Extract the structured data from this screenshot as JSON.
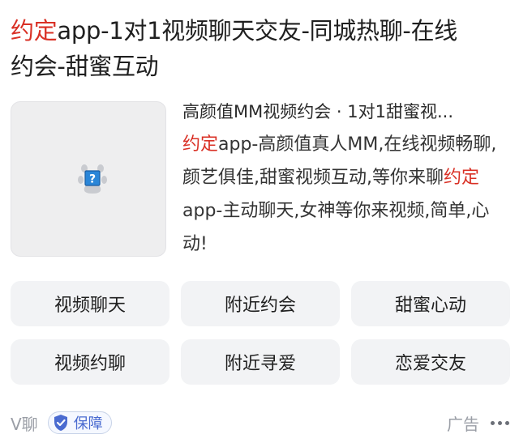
{
  "title": {
    "highlight": "约定",
    "rest_line1": "app-1对1视频聊天交友-同城热聊-在线",
    "line2": "约会-甜蜜互动"
  },
  "desc": {
    "subtitle": "高颜值MM视频约会 · 1对1甜蜜视...",
    "body": [
      {
        "text": "约定",
        "hl": true
      },
      {
        "text": "app-高颜值真人MM,在线视频畅聊,颜艺俱佳,甜蜜视频互动,等你来聊",
        "hl": false
      },
      {
        "text": "约定",
        "hl": true
      },
      {
        "text": "app-主动聊天,女神等你来视频,简单,心动!",
        "hl": false
      }
    ]
  },
  "thumbnail": {
    "icon": "broken-image-paw-icon"
  },
  "tags": [
    "视频聊天",
    "附近约会",
    "甜蜜心动",
    "视频约聊",
    "附近寻爱",
    "恋爱交友"
  ],
  "footer": {
    "source": "V聊",
    "badge": "保障",
    "ad_label": "广告",
    "more_icon": "more-dots-icon"
  },
  "colors": {
    "highlight": "#d93025",
    "badge_blue": "#4a6bd0",
    "tag_bg": "#f2f3f5",
    "muted": "#9a9ea6"
  }
}
